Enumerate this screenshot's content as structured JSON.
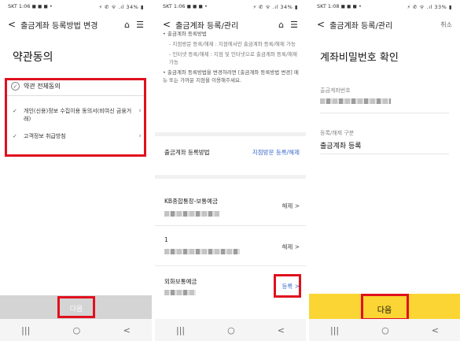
{
  "screens": [
    {
      "status": {
        "left": "SKT 1:06 ◼ ◼ ◼ •",
        "right": "⚡ ✆ ᯤ .ıl 34% ▮"
      },
      "title": "출금계좌 등록방법 변경",
      "heading": "약관동의",
      "agree_all": "약관 전체동의",
      "terms": [
        {
          "label": "개인(신용)정보 수집이용 동의서(비여신 금융거래)"
        },
        {
          "label": "고객정보 취급방침"
        }
      ],
      "next": "다음"
    },
    {
      "status": {
        "left": "SKT 1:06 ◼ ◼ ◼ •",
        "right": "⚡ ✆ ᯤ .ıl 34% ▮"
      },
      "title": "출금계좌 등록/관리",
      "info": [
        "• 출금계좌 등록방법",
        "- 지점방문 등록/해제 : 지점에서만 출금계좌 등록/해제 가능",
        "- 인터넷 등록/해제 : 지점 및 인터넷으로 출금계좌 등록/해제 가능",
        "• 출금계좌 등록방법을 변경하려면 [출금계좌 등록방법 변경] 메뉴 또는 가까운 지점을 이용해주세요."
      ],
      "method_label": "출금계좌 등록방법",
      "method_value": "지점방문 등록/해제",
      "accounts": [
        {
          "name": "KB종합통장-보통예금",
          "action": "해제 >"
        },
        {
          "name": "1",
          "action": "해제 >"
        },
        {
          "name": "외화보통예금",
          "action": "등록 >"
        }
      ]
    },
    {
      "status": {
        "left": "SKT 1:08 ◼ ◼ ◼ •",
        "right": "⚡ ✆ ᯤ .ıl 33% ▮"
      },
      "title": "출금계좌 등록/관리",
      "cancel": "취소",
      "heading": "계좌비밀번호 확인",
      "account_label": "출금계좌번호",
      "type_label": "등록/해제 구분",
      "type_value": "출금계좌 등록",
      "next": "다음"
    }
  ],
  "nav": {
    "recent": "|||",
    "home": "○",
    "back": "<"
  },
  "icons": {
    "home": "home-icon",
    "menu": "menu-icon",
    "back": "back-arrow-icon"
  },
  "colors": {
    "highlight": "#e0101e",
    "link": "#3a68c9",
    "confirm_bar": "#fad534",
    "disabled_bar": "#d4d4d4"
  }
}
